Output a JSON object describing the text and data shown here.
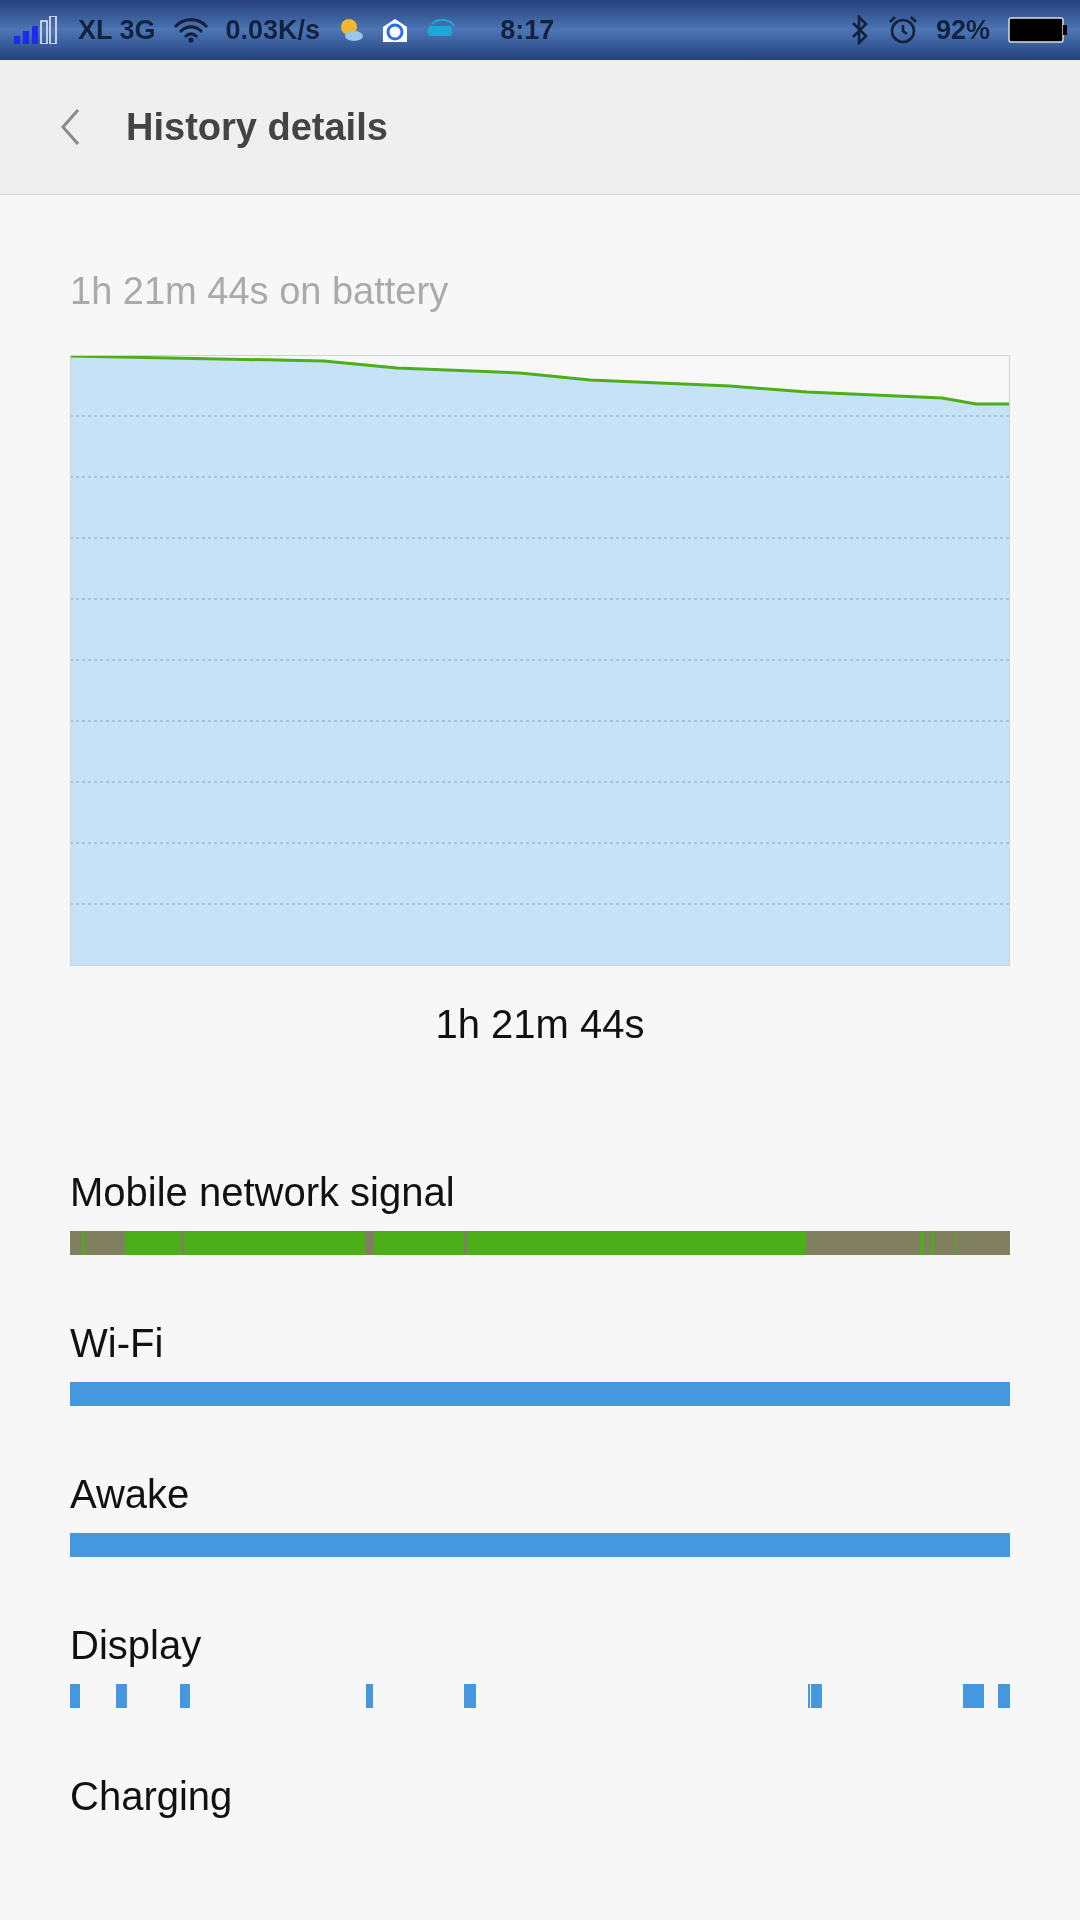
{
  "status_bar": {
    "carrier": "XL 3G",
    "speed": "0.03K/s",
    "time": "8:17",
    "battery": "92%"
  },
  "header": {
    "title": "History details"
  },
  "summary": "1h 21m 44s on battery",
  "chart_caption": "1h 21m 44s",
  "tracks": [
    {
      "label": "Mobile network signal",
      "kind": "signal"
    },
    {
      "label": "Wi-Fi",
      "kind": "solid"
    },
    {
      "label": "Awake",
      "kind": "solid"
    },
    {
      "label": "Display",
      "kind": "ticks"
    },
    {
      "label": "Charging",
      "kind": "empty"
    }
  ]
}
